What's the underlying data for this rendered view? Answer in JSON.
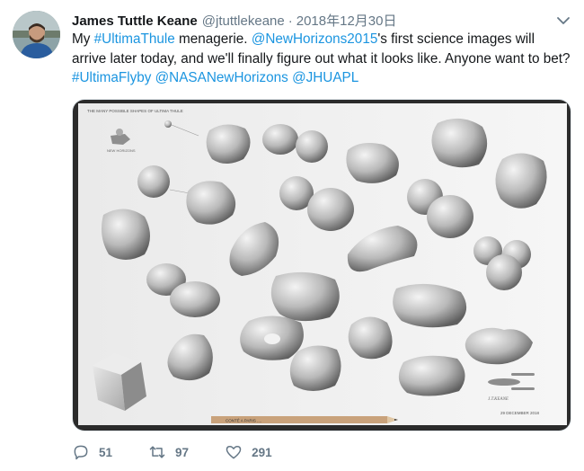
{
  "tweet": {
    "name": "James Tuttle Keane",
    "handle": "@jtuttlekeane",
    "separator": "·",
    "time": "2018年12月30日",
    "body": {
      "t1": "My ",
      "h1": "#UltimaThule",
      "t2": " menagerie. ",
      "m1": "@NewHorizons2015",
      "t3": "'s first science images will arrive later today, and we'll finally figure out what it looks like. Anyone want to bet? ",
      "h2": "#UltimaFlyby",
      "t4": " ",
      "m2": "@NASANewHorizons",
      "t5": " ",
      "m3": "@JHUAPL"
    },
    "media": {
      "sheet_title": "THE MANY POSSIBLE SHAPES OF ULTIMA THULE",
      "probe_caption": "NEW HORIZONS",
      "signature": "J.T.KEANE",
      "date": "29 DECEMBER 2018",
      "pencil_text": "CONTÉ A PARIS ...."
    },
    "actions": {
      "replies": "51",
      "retweets": "97",
      "likes": "291"
    },
    "colors": {
      "link": "#1b95e0",
      "muted": "#657786"
    }
  }
}
